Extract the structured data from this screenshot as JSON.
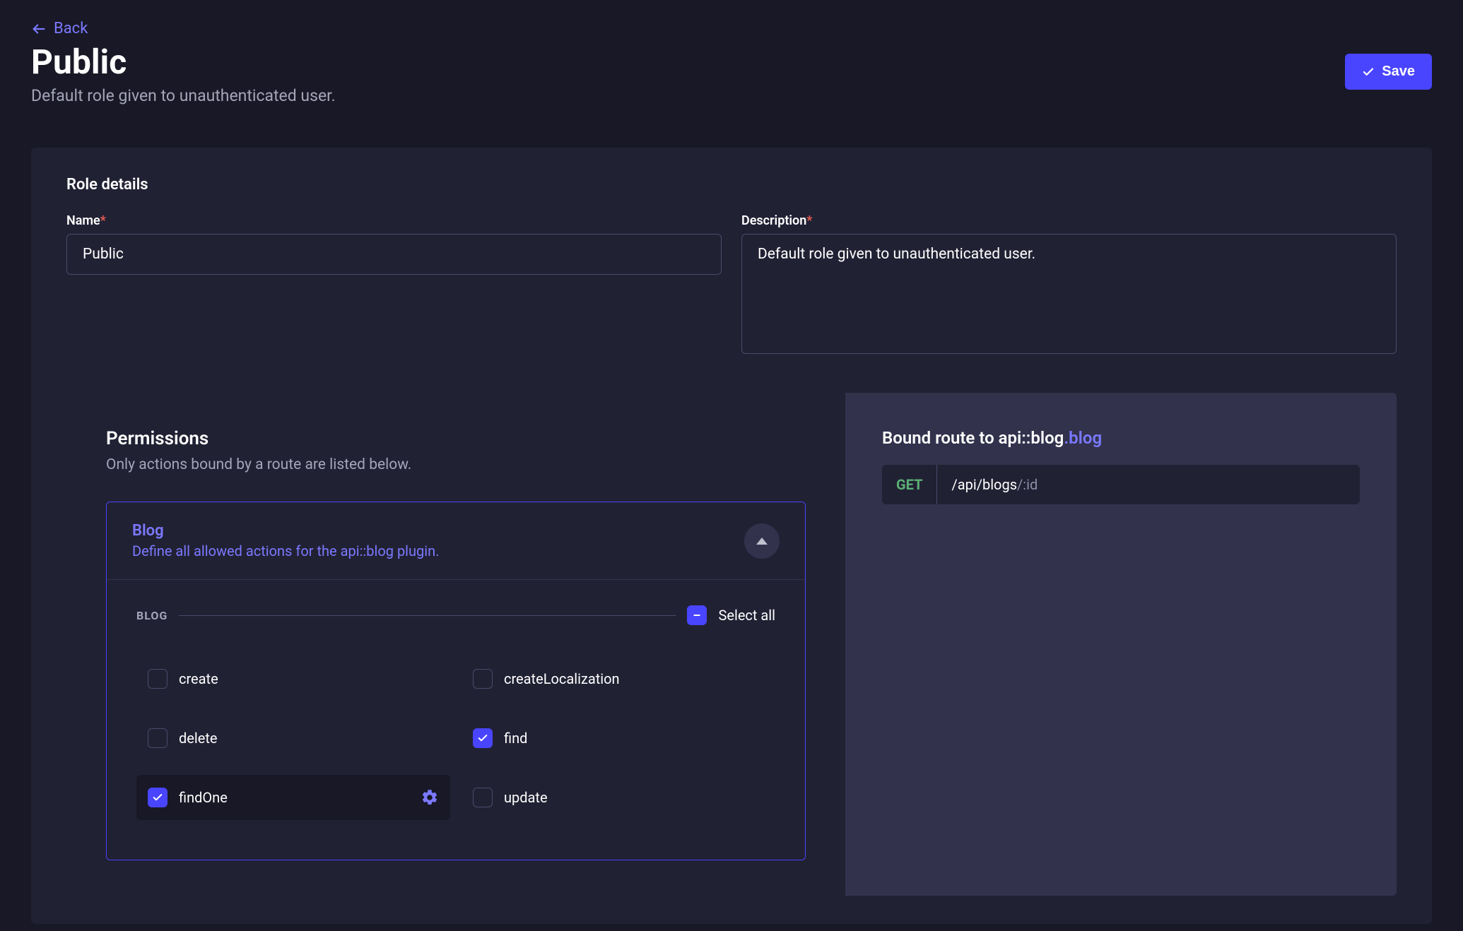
{
  "header": {
    "back_label": "Back",
    "title": "Public",
    "subtitle": "Default role given to unauthenticated user.",
    "save_label": "Save"
  },
  "role_details": {
    "section_title": "Role details",
    "name_label": "Name",
    "name_value": "Public",
    "desc_label": "Description",
    "desc_value": "Default role given to unauthenticated user."
  },
  "permissions": {
    "title": "Permissions",
    "subtitle": "Only actions bound by a route are listed below.",
    "plugin": {
      "name": "Blog",
      "desc": "Define all allowed actions for the api::blog plugin.",
      "group_label": "BLOG",
      "select_all_label": "Select all",
      "select_all_state": "indeterminate",
      "actions": [
        {
          "label": "create",
          "checked": false,
          "highlighted": false
        },
        {
          "label": "createLocalization",
          "checked": false,
          "highlighted": false
        },
        {
          "label": "delete",
          "checked": false,
          "highlighted": false
        },
        {
          "label": "find",
          "checked": true,
          "highlighted": false
        },
        {
          "label": "findOne",
          "checked": true,
          "highlighted": true
        },
        {
          "label": "update",
          "checked": false,
          "highlighted": false
        }
      ]
    }
  },
  "route": {
    "title_prefix": "Bound route to api::blog",
    "title_suffix": ".blog",
    "method": "GET",
    "path_base": "/api/blogs",
    "path_param": "/:id"
  }
}
